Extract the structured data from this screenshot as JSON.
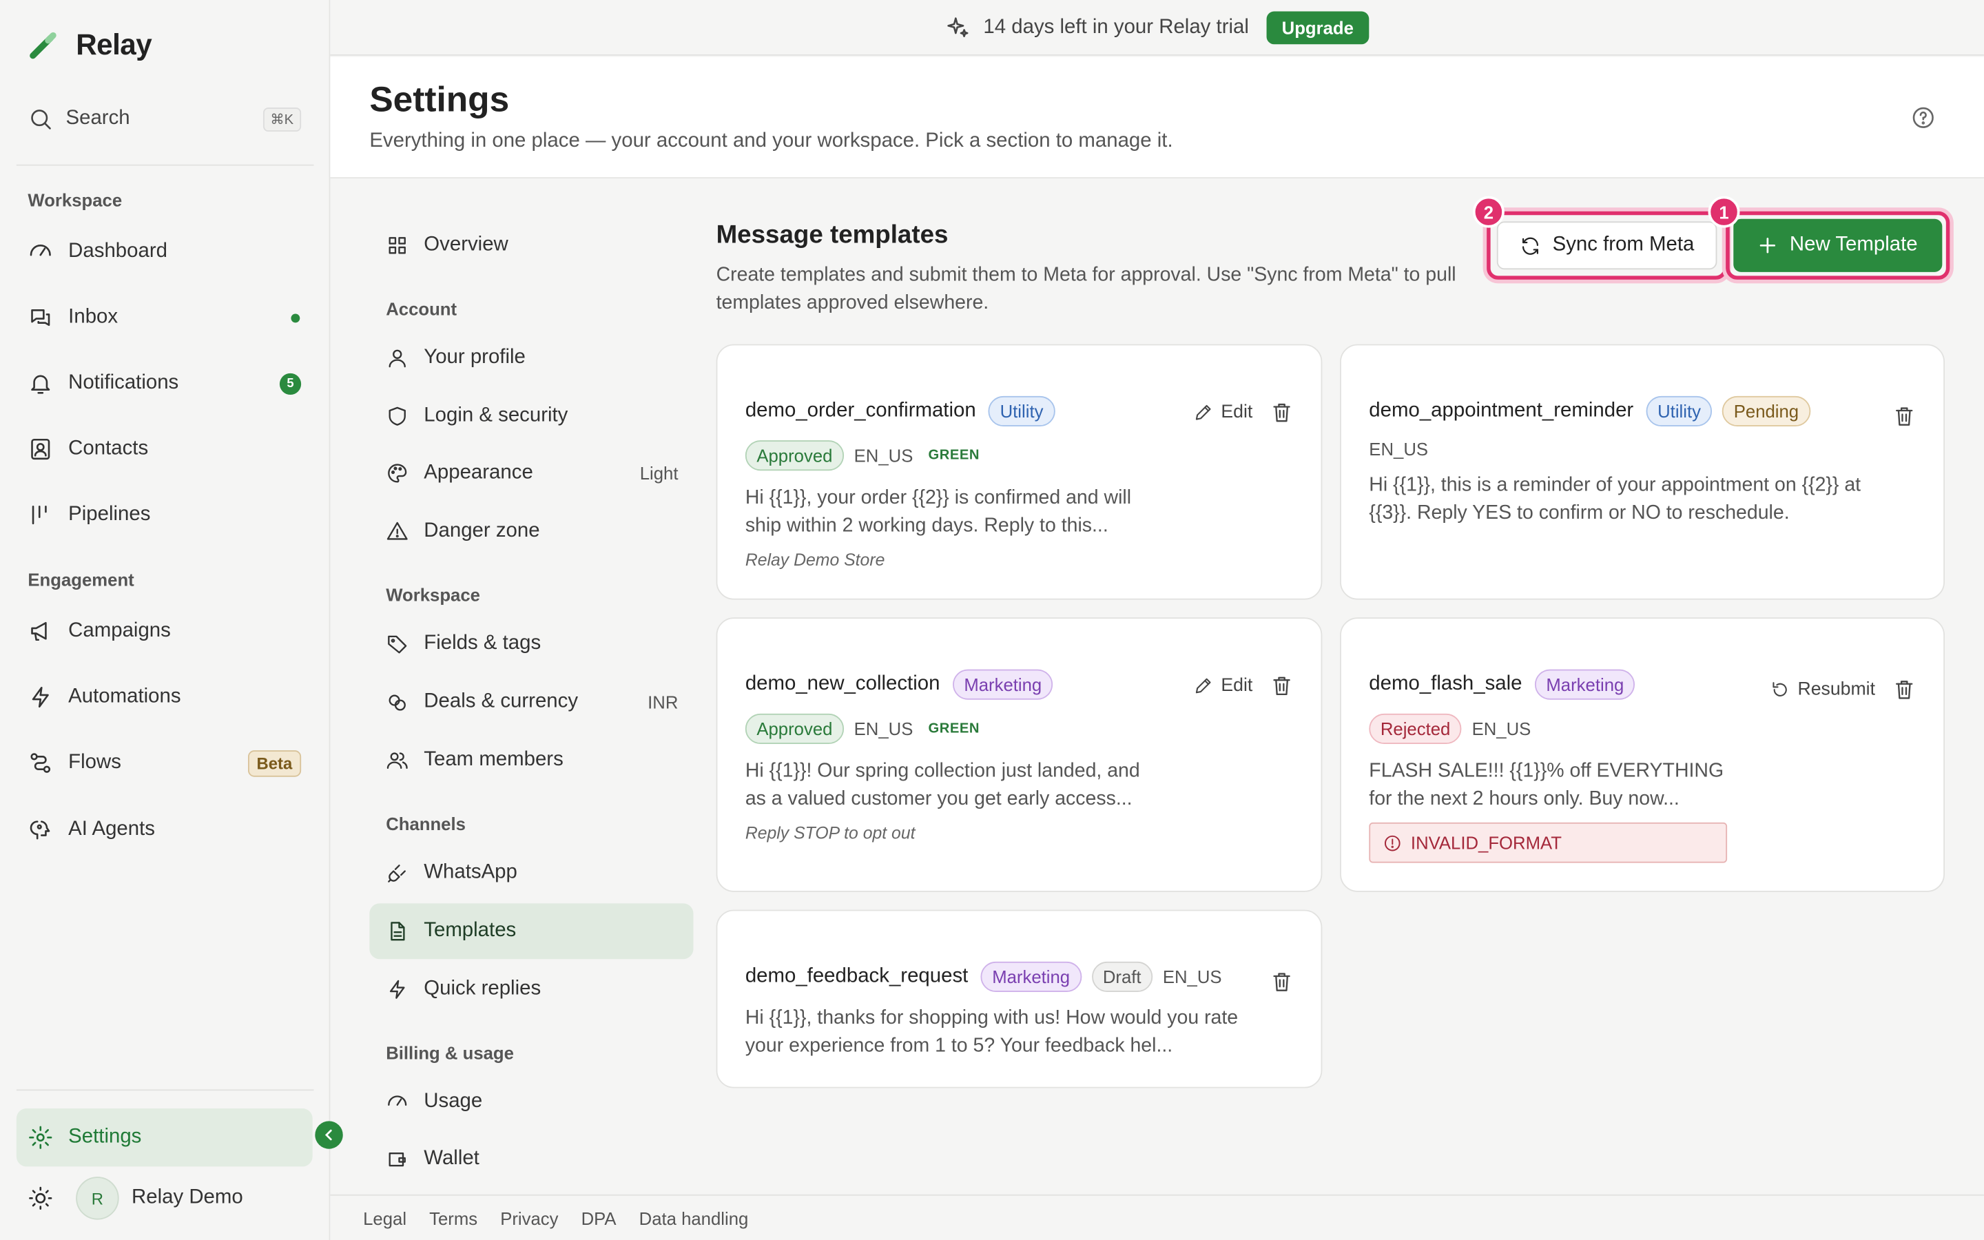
{
  "app": {
    "name": "Relay"
  },
  "banner": {
    "text": "14 days left in your Relay trial",
    "upgrade_label": "Upgrade"
  },
  "sidebar": {
    "search": {
      "label": "Search",
      "shortcut": "⌘K"
    },
    "sections": {
      "workspace": "Workspace",
      "engagement": "Engagement"
    },
    "items": [
      {
        "label": "Dashboard",
        "icon": "gauge-icon"
      },
      {
        "label": "Inbox",
        "icon": "inbox-icon"
      },
      {
        "label": "Notifications",
        "icon": "bell-icon",
        "count": "5"
      },
      {
        "label": "Contacts",
        "icon": "contacts-icon"
      },
      {
        "label": "Pipelines",
        "icon": "pipelines-icon"
      },
      {
        "label": "Campaigns",
        "icon": "megaphone-icon"
      },
      {
        "label": "Automations",
        "icon": "bolt-icon"
      },
      {
        "label": "Flows",
        "icon": "flows-icon",
        "badge": "Beta"
      },
      {
        "label": "AI Agents",
        "icon": "ai-agent-icon"
      },
      {
        "label": "Settings",
        "icon": "gear-icon"
      }
    ],
    "user": {
      "initial": "R",
      "name": "Relay Demo"
    }
  },
  "header": {
    "title": "Settings",
    "subtitle": "Everything in one place — your account and your workspace. Pick a section to manage it."
  },
  "settings_nav": {
    "overview": "Overview",
    "sections": {
      "account": "Account",
      "workspace": "Workspace",
      "channels": "Channels",
      "billing": "Billing & usage"
    },
    "account": [
      {
        "label": "Your profile"
      },
      {
        "label": "Login & security"
      },
      {
        "label": "Appearance",
        "meta": "Light"
      },
      {
        "label": "Danger zone"
      }
    ],
    "workspace": [
      {
        "label": "Fields & tags"
      },
      {
        "label": "Deals & currency",
        "meta": "INR"
      },
      {
        "label": "Team members"
      }
    ],
    "channels": [
      {
        "label": "WhatsApp"
      },
      {
        "label": "Templates"
      },
      {
        "label": "Quick replies"
      }
    ],
    "billing": [
      {
        "label": "Usage"
      },
      {
        "label": "Wallet"
      }
    ]
  },
  "content": {
    "title": "Message templates",
    "description": "Create templates and submit them to Meta for approval. Use \"Sync from Meta\" to pull templates approved elsewhere.",
    "sync_label": "Sync from Meta",
    "new_label": "New Template",
    "markers": [
      "1",
      "2"
    ]
  },
  "templates": [
    {
      "name": "demo_order_confirmation",
      "category": "Utility",
      "status": "Approved",
      "locale": "EN_US",
      "quality": "GREEN",
      "body": "Hi {{1}}, your order {{2}} is confirmed and will ship within 2 working days. Reply to this...",
      "footer": "Relay Demo Store",
      "edit_label": "Edit"
    },
    {
      "name": "demo_appointment_reminder",
      "category": "Utility",
      "status": "Pending",
      "locale": "EN_US",
      "body": "Hi {{1}}, this is a reminder of your appointment on {{2}} at {{3}}. Reply YES to confirm or NO to reschedule."
    },
    {
      "name": "demo_new_collection",
      "category": "Marketing",
      "status": "Approved",
      "locale": "EN_US",
      "quality": "GREEN",
      "body": "Hi {{1}}! Our spring collection just landed, and as a valued customer you get early access...",
      "footer": "Reply STOP to opt out",
      "edit_label": "Edit"
    },
    {
      "name": "demo_flash_sale",
      "category": "Marketing",
      "status": "Rejected",
      "locale": "EN_US",
      "body": "FLASH SALE!!! {{1}}% off EVERYTHING for the next 2 hours only. Buy now...",
      "error": "INVALID_FORMAT",
      "resubmit_label": "Resubmit"
    },
    {
      "name": "demo_feedback_request",
      "category": "Marketing",
      "status": "Draft",
      "locale": "EN_US",
      "body": "Hi {{1}}, thanks for shopping with us! How would you rate your experience from 1 to 5? Your feedback hel..."
    }
  ],
  "footer": {
    "links": [
      "Legal",
      "Terms",
      "Privacy",
      "DPA",
      "Data handling"
    ]
  },
  "colors": {
    "accent": "#2a8a3e",
    "highlight": "#e0306d"
  }
}
